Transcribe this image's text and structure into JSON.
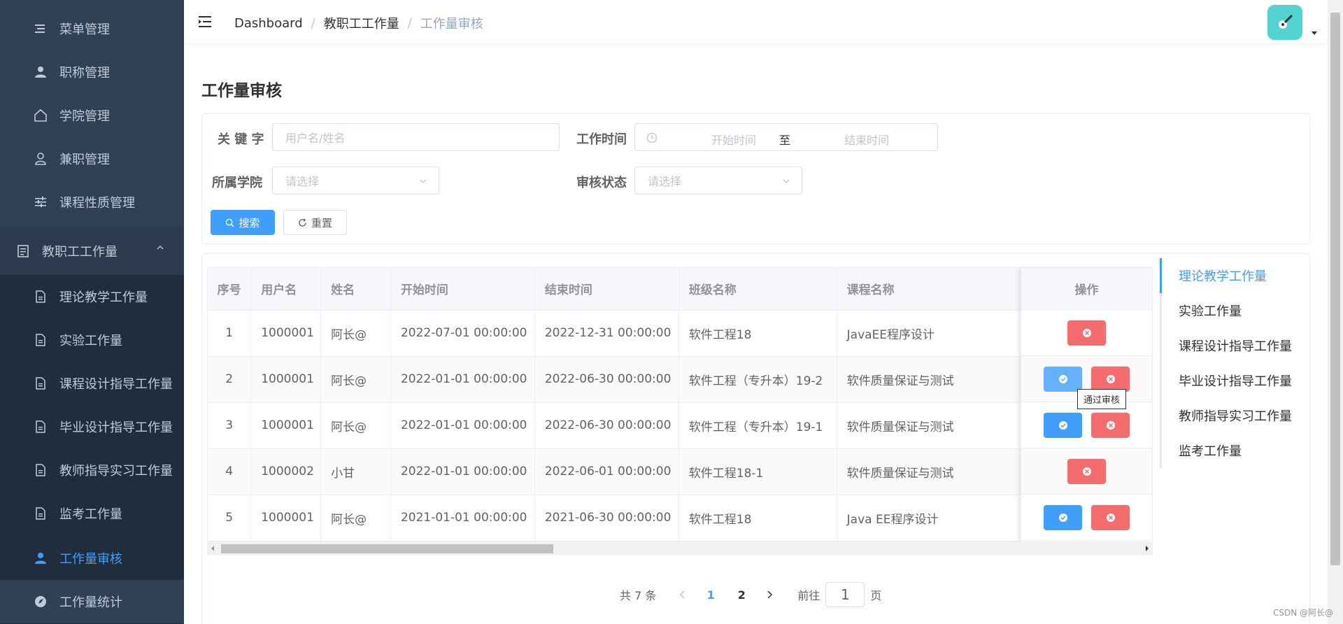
{
  "sidebar": {
    "items": [
      {
        "label": "菜单管理",
        "icon": "menu-lines-icon"
      },
      {
        "label": "职称管理",
        "icon": "user-icon"
      },
      {
        "label": "学院管理",
        "icon": "home-icon"
      },
      {
        "label": "兼职管理",
        "icon": "user-outline-icon"
      },
      {
        "label": "课程性质管理",
        "icon": "sliders-icon"
      }
    ],
    "group": {
      "label": "教职工工作量",
      "icon": "document-icon"
    },
    "subitems": [
      {
        "label": "理论教学工作量"
      },
      {
        "label": "实验工作量"
      },
      {
        "label": "课程设计指导工作量"
      },
      {
        "label": "毕业设计指导工作量"
      },
      {
        "label": "教师指导实习工作量"
      },
      {
        "label": "监考工作量"
      },
      {
        "label": "工作量审核"
      }
    ],
    "bottom": {
      "label": "工作量统计",
      "icon": "compass-icon"
    },
    "colors": {
      "bg": "#304156",
      "text": "#bfcbd9",
      "active": "#409eff"
    }
  },
  "header": {
    "breadcrumb": [
      "Dashboard",
      "教职工工作量",
      "工作量审核"
    ]
  },
  "page": {
    "title": "工作量审核"
  },
  "filters": {
    "keyword_label": "关 键 字",
    "keyword_placeholder": "用户名/姓名",
    "worktime_label": "工作时间",
    "start_placeholder": "开始时间",
    "range_sep": "至",
    "end_placeholder": "结束时间",
    "college_label": "所属学院",
    "college_placeholder": "请选择",
    "status_label": "审核状态",
    "status_placeholder": "请选择",
    "search_label": "搜索",
    "reset_label": "重置"
  },
  "table": {
    "headers": [
      "序号",
      "用户名",
      "姓名",
      "开始时间",
      "结束时间",
      "班级名称",
      "课程名称"
    ],
    "ops_header": "操作",
    "rows": [
      {
        "idx": "1",
        "username": "1000001",
        "name": "阿长@",
        "start": "2022-07-01 00:00:00",
        "end": "2022-12-31 00:00:00",
        "class": "软件工程18",
        "course": "JavaEE程序设计",
        "ops": [
          "reject"
        ]
      },
      {
        "idx": "2",
        "username": "1000001",
        "name": "阿长@",
        "start": "2022-01-01 00:00:00",
        "end": "2022-06-30 00:00:00",
        "class": "软件工程（专升本）19-2",
        "course": "软件质量保证与测试",
        "ops": [
          "pass",
          "reject"
        ]
      },
      {
        "idx": "3",
        "username": "1000001",
        "name": "阿长@",
        "start": "2022-01-01 00:00:00",
        "end": "2022-06-30 00:00:00",
        "class": "软件工程（专升本）19-1",
        "course": "软件质量保证与测试",
        "ops": [
          "pass",
          "reject"
        ]
      },
      {
        "idx": "4",
        "username": "1000002",
        "name": "小甘",
        "start": "2022-01-01 00:00:00",
        "end": "2022-06-01 00:00:00",
        "class": "软件工程18-1",
        "course": "软件质量保证与测试",
        "ops": [
          "reject"
        ]
      },
      {
        "idx": "5",
        "username": "1000001",
        "name": "阿长@",
        "start": "2021-01-01 00:00:00",
        "end": "2021-06-30 00:00:00",
        "class": "软件工程18",
        "course": "Java EE程序设计",
        "ops": [
          "pass",
          "reject"
        ]
      }
    ],
    "tooltip": "通过审核"
  },
  "sidenav": {
    "items": [
      "理论教学工作量",
      "实验工作量",
      "课程设计指导工作量",
      "毕业设计指导工作量",
      "教师指导实习工作量",
      "监考工作量"
    ],
    "active": "理论教学工作量"
  },
  "pagination": {
    "total_text": "共 7 条",
    "pages": [
      "1",
      "2"
    ],
    "current": "1",
    "goto_label": "前往",
    "goto_value": "1",
    "page_suffix": "页"
  },
  "watermark": "CSDN @阿长@"
}
